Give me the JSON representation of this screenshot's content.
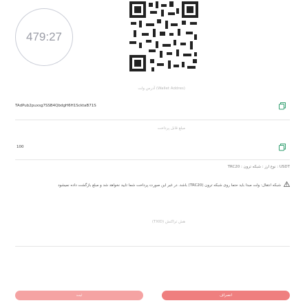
{
  "timer": {
    "value": "479:27"
  },
  "wallet_address": {
    "label": "(Wallet Addres) آدرس ولت",
    "value": "TAdPub2puxsg7SSB4QbdgH6H1ScktaB71S"
  },
  "amount": {
    "label": "مبلغ قابل پرداخت",
    "value": "100"
  },
  "network_info": "USDT : نوع ارز : شبکه ترون : TRC20",
  "warning_text": "شبکه انتقال: ولت مبدا باید حتما روی شبکه ترون (TRC20) باشد. در غیر این صورت پرداخت شما تایید نخواهد شد و مبلغ بازگشت داده نمیشود",
  "hash_field": {
    "label": "هش تراکنش (TXID)"
  },
  "buttons": {
    "left_label": "ثبت",
    "right_label": "انصراف"
  },
  "colors": {
    "accent": "#ef7f7f",
    "accent_light": "#f5a3a3",
    "copy_icon": "#2f9e6e"
  },
  "icons": {
    "copy": "copy-icon",
    "alert": "alert-triangle-icon"
  }
}
